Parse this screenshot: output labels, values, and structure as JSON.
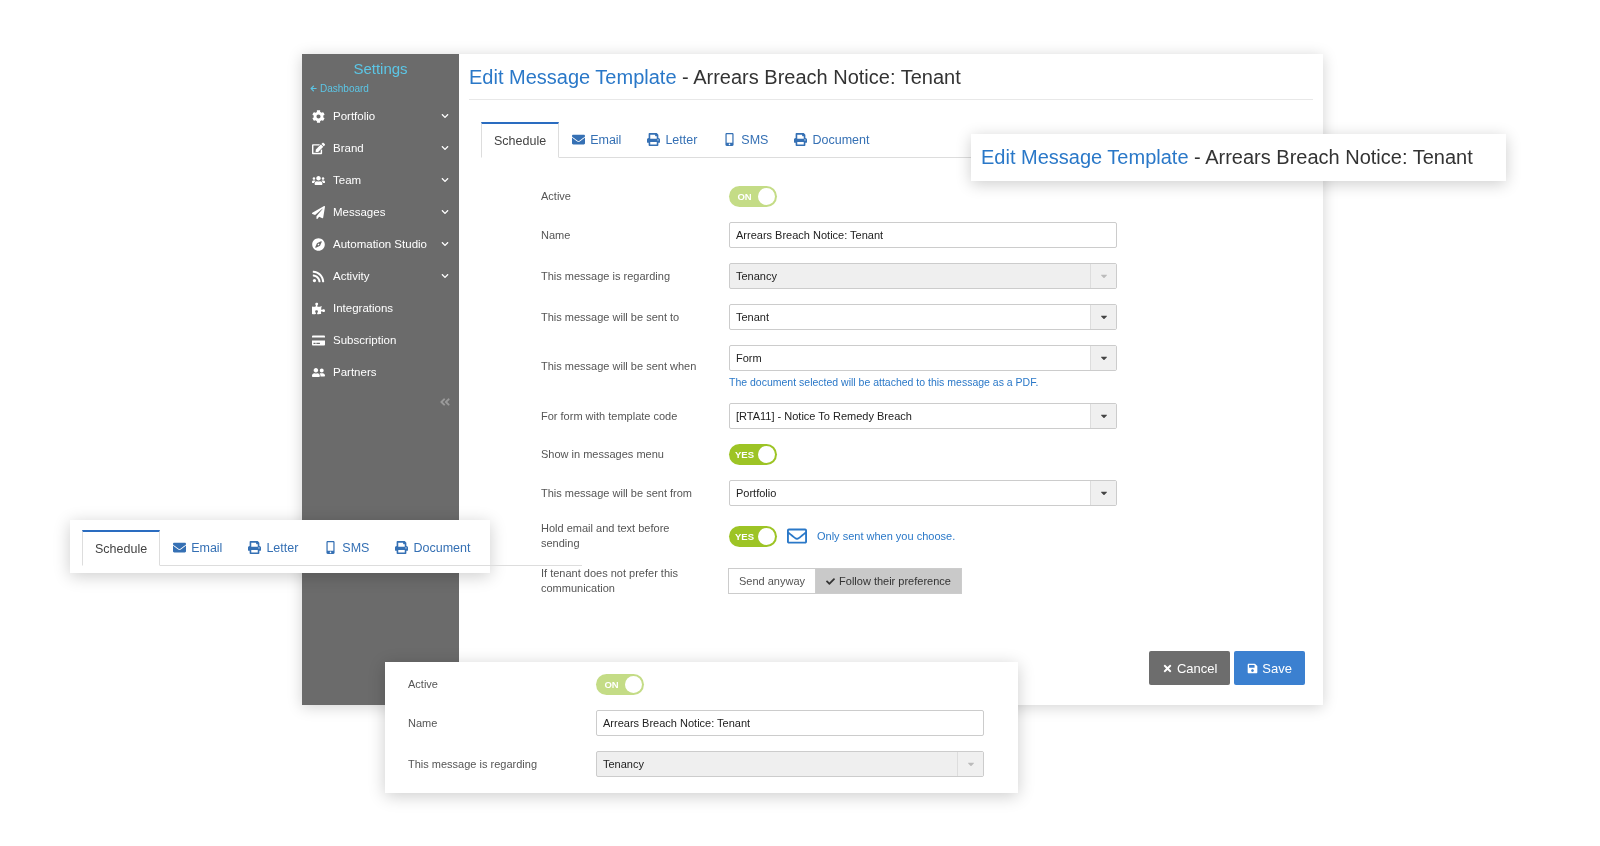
{
  "sidebar": {
    "title": "Settings",
    "back_link": "Dashboard",
    "items": [
      {
        "label": "Portfolio",
        "expandable": true
      },
      {
        "label": "Brand",
        "expandable": true
      },
      {
        "label": "Team",
        "expandable": true
      },
      {
        "label": "Messages",
        "expandable": true
      },
      {
        "label": "Automation Studio",
        "expandable": true
      },
      {
        "label": "Activity",
        "expandable": true
      },
      {
        "label": "Integrations",
        "expandable": false
      },
      {
        "label": "Subscription",
        "expandable": false
      },
      {
        "label": "Partners",
        "expandable": false
      }
    ]
  },
  "main": {
    "title_link": "Edit Message Template",
    "title_rest": " - Arrears Breach Notice: Tenant",
    "tabs": [
      {
        "label": "Schedule",
        "selected": true
      },
      {
        "label": "Email",
        "selected": false
      },
      {
        "label": "Letter",
        "selected": false
      },
      {
        "label": "SMS",
        "selected": false
      },
      {
        "label": "Document",
        "selected": false
      }
    ],
    "fields": [
      {
        "kind": "toggle",
        "label": "Active",
        "value": "ON",
        "on": true,
        "disabled": true
      },
      {
        "kind": "text",
        "label": "Name",
        "value": "Arrears Breach Notice: Tenant"
      },
      {
        "kind": "select",
        "label": "This message is regarding",
        "value": "Tenancy",
        "disabled": true
      },
      {
        "kind": "select",
        "label": "This message will be sent to",
        "value": "Tenant",
        "disabled": false
      },
      {
        "kind": "select",
        "label": "This message will be sent when",
        "value": "Form",
        "disabled": false,
        "help": "The document selected will be attached to this message as a PDF."
      },
      {
        "kind": "select",
        "label": "For form with template code",
        "value": "[RTA11] - Notice To Remedy Breach",
        "disabled": false
      },
      {
        "kind": "toggle",
        "label": "Show in messages menu",
        "value": "YES",
        "on": true,
        "disabled": false
      },
      {
        "kind": "select",
        "label": "This message will be sent from",
        "value": "Portfolio",
        "disabled": false
      },
      {
        "kind": "toggle",
        "label": "Hold email and text before sending",
        "value": "YES",
        "on": true,
        "disabled": false,
        "note": "Only sent when you choose."
      },
      {
        "kind": "segmented",
        "label": "If tenant does not prefer this communication",
        "options": [
          {
            "label": "Send anyway",
            "selected": false
          },
          {
            "label": "Follow their preference",
            "selected": true
          }
        ]
      }
    ],
    "buttons": [
      {
        "kind": "cancel",
        "label": "Cancel"
      },
      {
        "kind": "save",
        "label": "Save"
      }
    ]
  },
  "title_callout": {
    "title_link": "Edit Message Template",
    "title_rest": " - Arrears Breach Notice: Tenant"
  },
  "tabs_callout": {
    "tabs": [
      {
        "label": "Schedule",
        "selected": true
      },
      {
        "label": "Email",
        "selected": false
      },
      {
        "label": "Letter",
        "selected": false
      },
      {
        "label": "SMS",
        "selected": false
      },
      {
        "label": "Document",
        "selected": false
      }
    ]
  },
  "form_callout": {
    "fields": [
      {
        "kind": "toggle",
        "label": "Active",
        "value": "ON",
        "on": true,
        "disabled": true
      },
      {
        "kind": "text",
        "label": "Name",
        "value": "Arrears Breach Notice: Tenant"
      },
      {
        "kind": "select",
        "label": "This message is regarding",
        "value": "Tenancy",
        "disabled": true
      }
    ]
  }
}
